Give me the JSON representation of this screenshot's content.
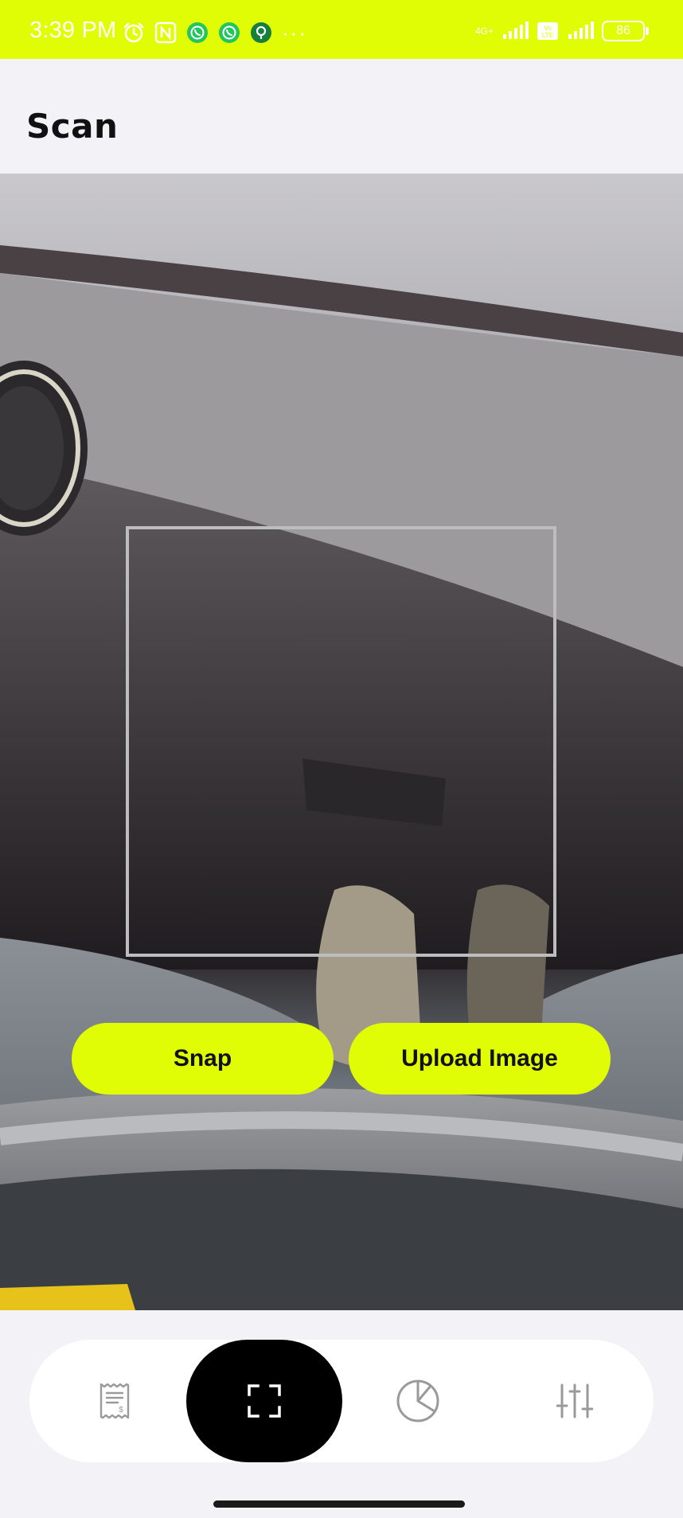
{
  "status_bar": {
    "time": "3:39 PM",
    "network_label": "4G+",
    "battery": "86",
    "more_indicator": "···",
    "background_color": "#e0fd05"
  },
  "header": {
    "title": "Scan"
  },
  "scanner": {
    "snap_label": "Snap",
    "upload_label": "Upload Image",
    "accent_color": "#e0fd05"
  },
  "nav": {
    "items": [
      {
        "icon": "receipt-icon",
        "active": false
      },
      {
        "icon": "scan-frame-icon",
        "active": true
      },
      {
        "icon": "pie-chart-icon",
        "active": false
      },
      {
        "icon": "sliders-icon",
        "active": false
      }
    ]
  }
}
